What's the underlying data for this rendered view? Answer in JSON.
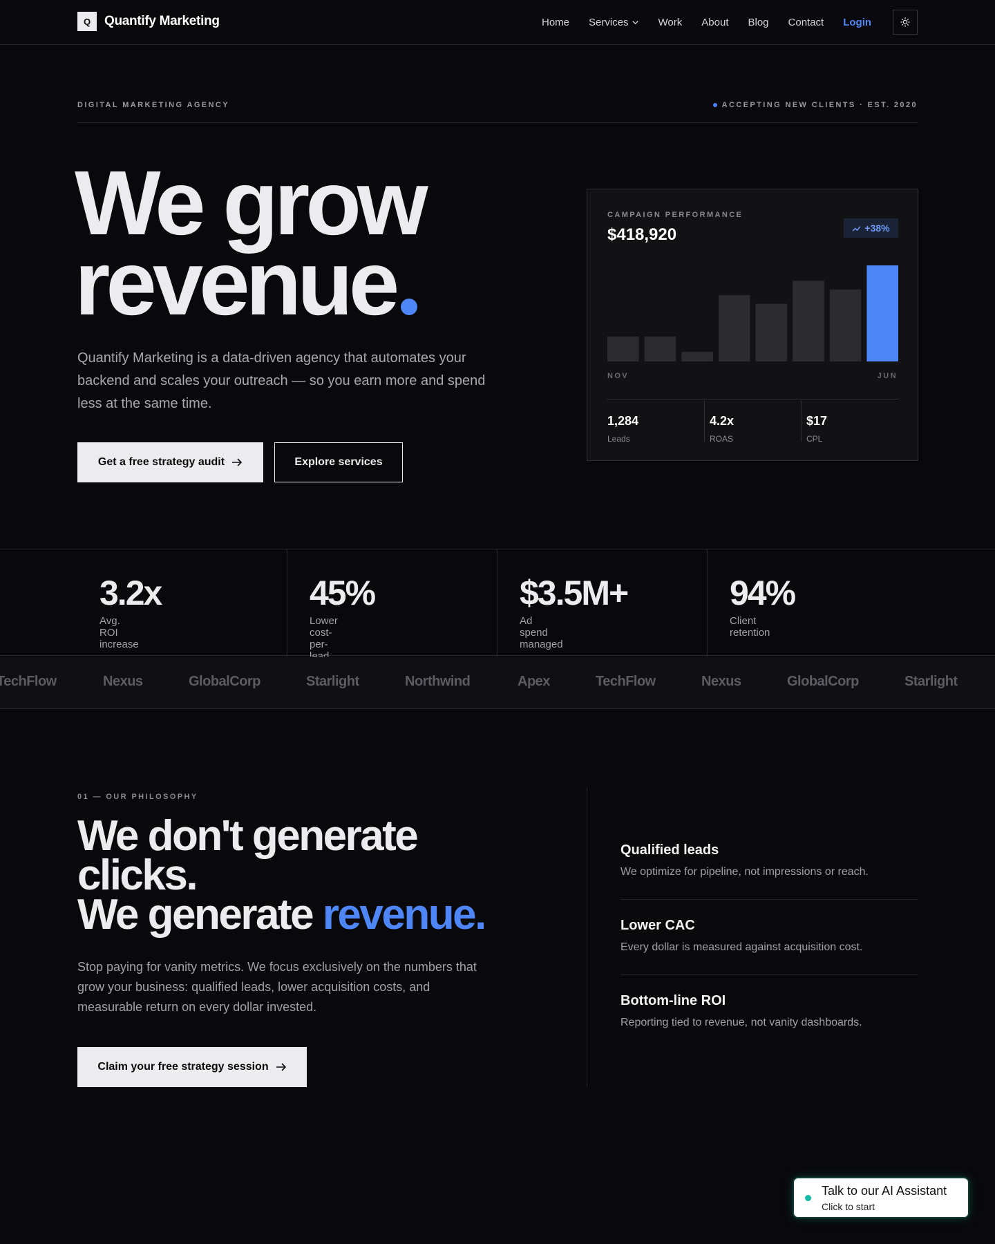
{
  "nav": {
    "brand_mark": "Q",
    "brand": "Quantify Marketing",
    "links": [
      "Home",
      "Services",
      "Work",
      "About",
      "Blog",
      "Contact"
    ],
    "login": "Login"
  },
  "hero": {
    "eyebrow_left": "DIGITAL MARKETING AGENCY",
    "eyebrow_right": "ACCEPTING NEW CLIENTS · EST. 2020",
    "title_line1": "We grow",
    "title_line2": "revenue",
    "description": "Quantify Marketing is a data-driven agency that automates your backend and scales your outreach — so you earn more and spend less at the same time.",
    "primary_cta": "Get a free strategy audit",
    "secondary_cta": "Explore services"
  },
  "campaign_card": {
    "label": "CAMPAIGN PERFORMANCE",
    "value": "$418,920",
    "badge": "+38%",
    "axis_start": "NOV",
    "axis_end": "JUN",
    "stats": [
      {
        "value": "1,284",
        "label": "Leads"
      },
      {
        "value": "4.2x",
        "label": "ROAS"
      },
      {
        "value": "$17",
        "label": "CPL"
      }
    ]
  },
  "chart_data": {
    "type": "bar",
    "values": [
      0.26,
      0.26,
      0.1,
      0.69,
      0.6,
      0.84,
      0.75,
      1.0
    ],
    "highlight_index": 7,
    "colors": {
      "bar": "#2b2b30",
      "highlight": "#4f86f7"
    }
  },
  "stats": [
    {
      "value": "3.2x",
      "label": "Avg. ROI increase"
    },
    {
      "value": "45%",
      "label": "Lower cost-per-lead"
    },
    {
      "value": "$3.5M+",
      "label": "Ad spend managed"
    },
    {
      "value": "94%",
      "label": "Client retention"
    }
  ],
  "clients": [
    "TechFlow",
    "Nexus",
    "GlobalCorp",
    "Starlight",
    "Northwind",
    "Apex",
    "TechFlow",
    "Nexus",
    "GlobalCorp",
    "Starlight"
  ],
  "philosophy": {
    "label": "01 — OUR PHILOSOPHY",
    "title_line1": "We don't generate",
    "title_line2": "clicks.",
    "title_line3_prefix": "We generate ",
    "title_accent": "revenue.",
    "description": "Stop paying for vanity metrics. We focus exclusively on the numbers that grow your business: qualified leads, lower acquisition costs, and measurable return on every dollar invested.",
    "cta": "Claim your free strategy session",
    "features": [
      {
        "title": "Qualified leads",
        "desc": "We optimize for pipeline, not impressions or reach."
      },
      {
        "title": "Lower CAC",
        "desc": "Every dollar is measured against acquisition cost."
      },
      {
        "title": "Bottom-line ROI",
        "desc": "Reporting tied to revenue, not vanity dashboards."
      }
    ]
  },
  "chat": {
    "title": "Talk to our AI Assistant",
    "subtitle": "Click to start"
  },
  "colors": {
    "accent": "#4f86f7",
    "background": "#09090b",
    "chat_dot": "#14b8a6"
  },
  "icons": [
    "chevron-down-icon",
    "sun-icon",
    "arrow-right-icon",
    "trend-up-icon"
  ]
}
